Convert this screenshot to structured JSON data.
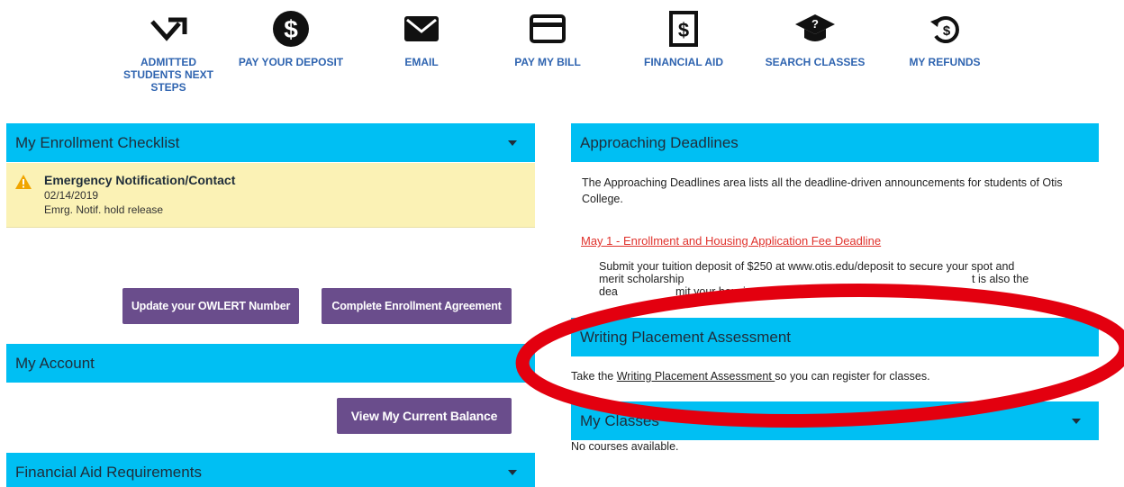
{
  "nav": [
    {
      "label": "ADMITTED STUDENTS NEXT STEPS",
      "icon": "trending-arrow-icon"
    },
    {
      "label": "PAY YOUR DEPOSIT",
      "icon": "dollar-circle-icon"
    },
    {
      "label": "EMAIL",
      "icon": "envelope-icon"
    },
    {
      "label": "PAY MY BILL",
      "icon": "credit-card-icon"
    },
    {
      "label": "FINANCIAL AID",
      "icon": "dollar-document-icon"
    },
    {
      "label": "SEARCH CLASSES",
      "icon": "graduation-cap-question-icon"
    },
    {
      "label": "MY REFUNDS",
      "icon": "refund-icon"
    }
  ],
  "enrollment_checklist": {
    "title": "My Enrollment Checklist",
    "item": {
      "title": "Emergency Notification/Contact",
      "date": "02/14/2019",
      "note": "Emrg. Notif. hold release"
    },
    "buttons": [
      "Update your OWLERT Number",
      "Complete Enrollment Agreement"
    ]
  },
  "my_account": {
    "title": "My Account",
    "button": "View My Current Balance"
  },
  "financial_aid": {
    "title": "Financial Aid Requirements"
  },
  "deadlines": {
    "title": "Approaching Deadlines",
    "intro": "The Approaching Deadlines area lists all the deadline-driven announcements for students of Otis College.",
    "link": "May 1 - Enrollment and Housing Application Fee Deadline",
    "body_line1": "Submit your tuition deposit of $250 at www.otis.edu/deposit to secure your spot and",
    "body_line2_start": "merit scholarship",
    "body_line2_end": "t is also the",
    "body_line3_start": "dea",
    "body_line3_end": "mit your housing application fee of $150."
  },
  "writing": {
    "title": "Writing Placement Assessment",
    "text_before": "Take the ",
    "link": "Writing Placement Assessment ",
    "text_after": "so you can register for classes."
  },
  "classes": {
    "title": "My Classes",
    "empty": "No courses available."
  },
  "colors": {
    "bar": "#00bff3",
    "button": "#6a4d8c",
    "nav_text": "#2f64b0",
    "alert_bg": "#fbf2b5",
    "deadline_link": "#e0322c",
    "annotation": "#e3000f"
  }
}
